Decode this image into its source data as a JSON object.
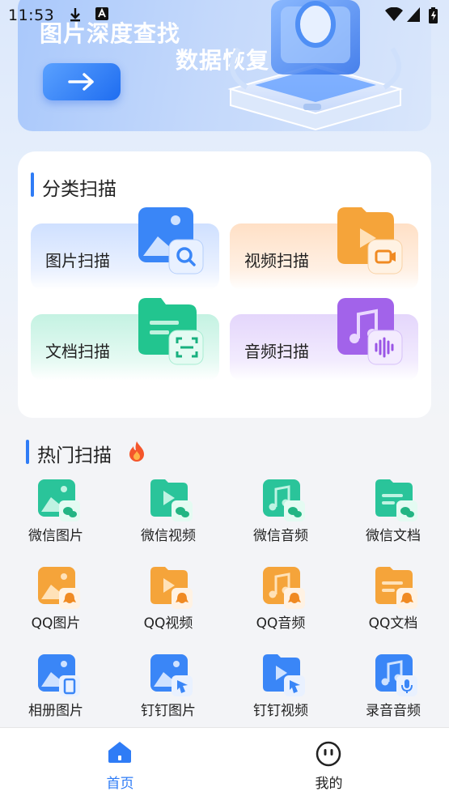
{
  "status_bar": {
    "time": "11:53"
  },
  "banner": {
    "title_line1": "图片深度查找",
    "title_line2": "数据恢复"
  },
  "categories": {
    "title": "分类扫描",
    "items": [
      {
        "label": "图片扫描",
        "icon": "image-search-icon",
        "color": "#3a86f7"
      },
      {
        "label": "视频扫描",
        "icon": "video-scan-icon",
        "color": "#f5a43a"
      },
      {
        "label": "文档扫描",
        "icon": "document-scan-icon",
        "color": "#22c58f"
      },
      {
        "label": "音频扫描",
        "icon": "audio-scan-icon",
        "color": "#a263ea"
      }
    ]
  },
  "hot": {
    "title": "热门扫描",
    "items": [
      {
        "label": "微信图片",
        "icon": "wechat-image-icon"
      },
      {
        "label": "微信视频",
        "icon": "wechat-video-icon"
      },
      {
        "label": "微信音频",
        "icon": "wechat-audio-icon"
      },
      {
        "label": "微信文档",
        "icon": "wechat-document-icon"
      },
      {
        "label": "QQ图片",
        "icon": "qq-image-icon"
      },
      {
        "label": "QQ视频",
        "icon": "qq-video-icon"
      },
      {
        "label": "QQ音频",
        "icon": "qq-audio-icon"
      },
      {
        "label": "QQ文档",
        "icon": "qq-document-icon"
      },
      {
        "label": "相册图片",
        "icon": "album-image-icon"
      },
      {
        "label": "钉钉图片",
        "icon": "dingtalk-image-icon"
      },
      {
        "label": "钉钉视频",
        "icon": "dingtalk-video-icon"
      },
      {
        "label": "录音音频",
        "icon": "recording-audio-icon"
      }
    ]
  },
  "nav": {
    "home_label": "首页",
    "mine_label": "我的",
    "active_color": "#2f7cf6",
    "inactive_color": "#222222"
  }
}
